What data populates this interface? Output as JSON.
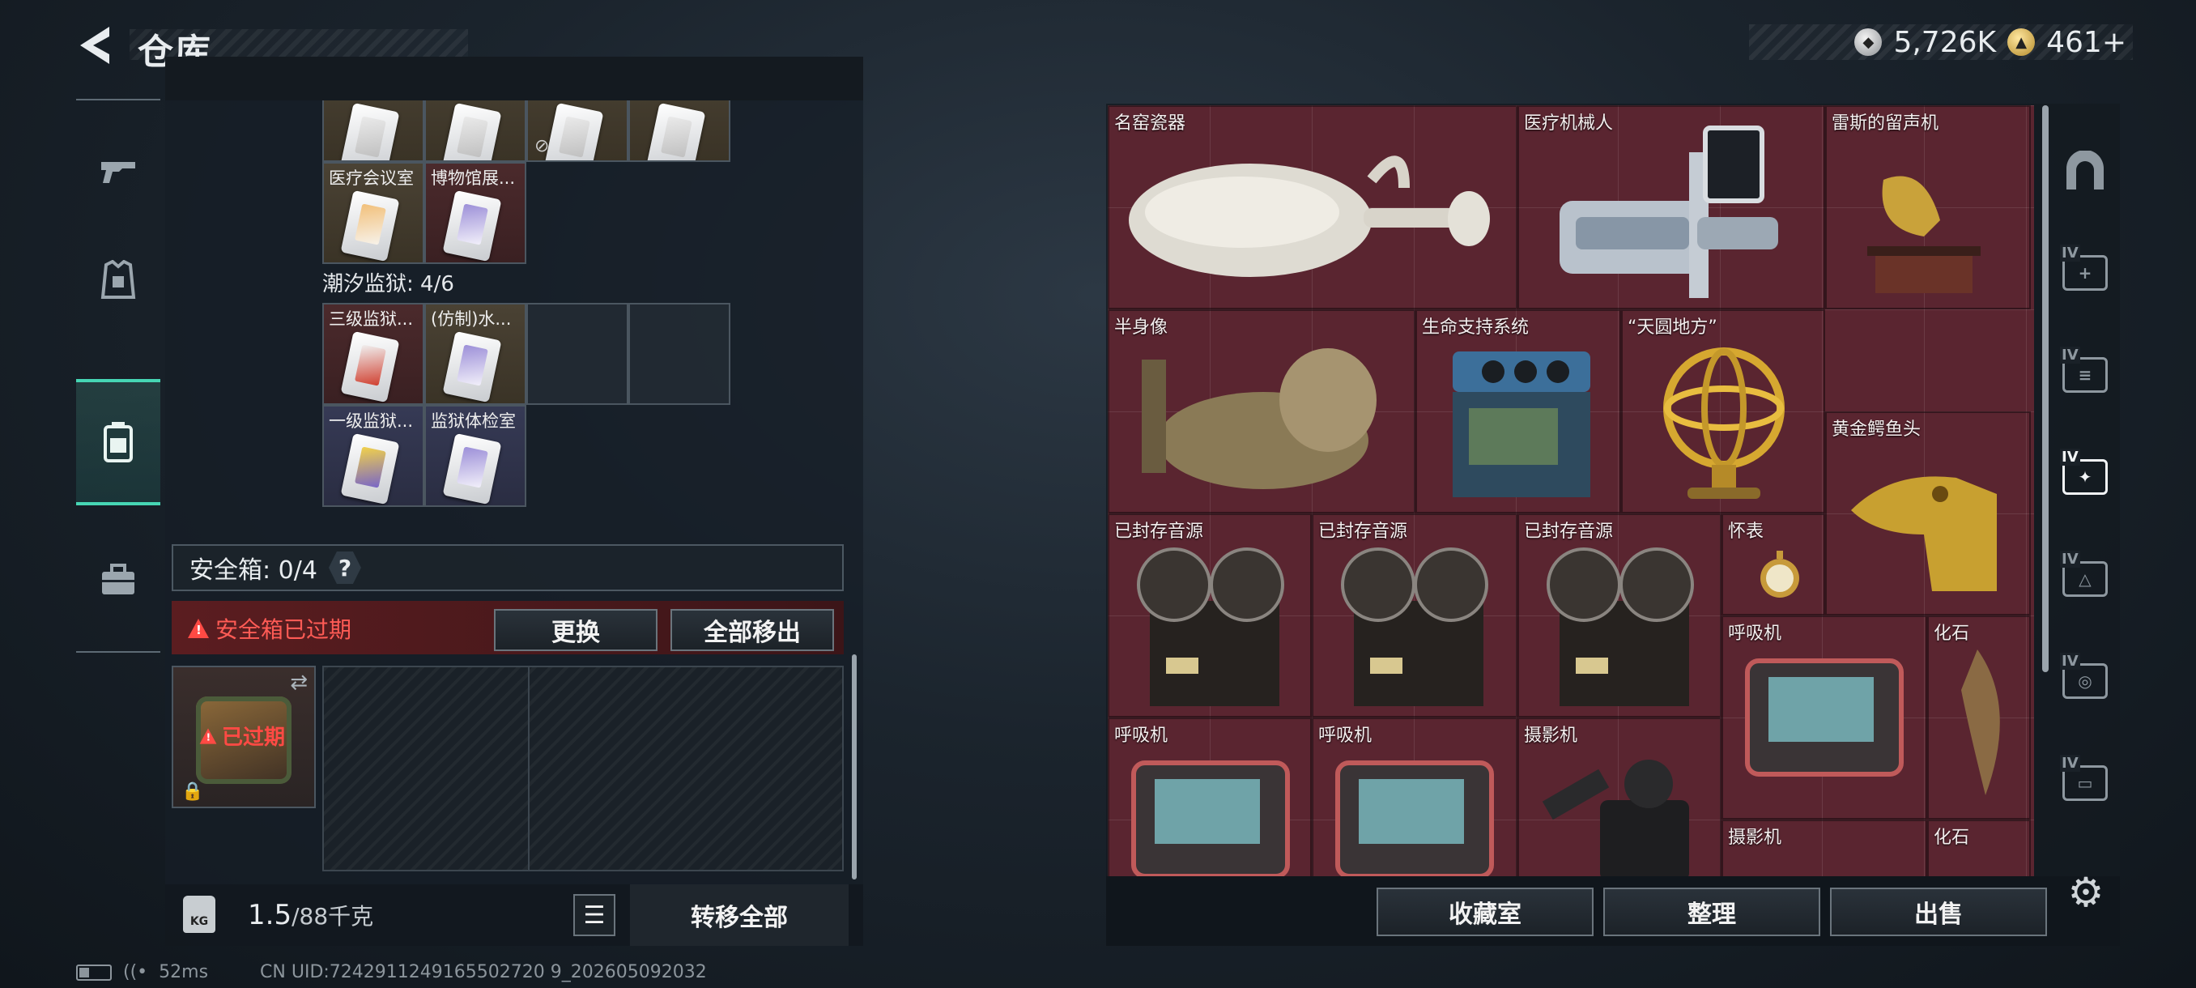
{
  "header": {
    "title": "仓库",
    "currency_silver": "5,726K",
    "currency_gold": "461+"
  },
  "left_panel": {
    "top_row_slots": [
      "",
      "",
      "",
      ""
    ],
    "row2": [
      {
        "label": "医疗会议室",
        "color": "orange"
      },
      {
        "label": "博物馆展...",
        "color": "purple"
      }
    ],
    "section_label": "潮汐监狱: 4/6",
    "prison_cards": [
      {
        "label": "三级监狱...",
        "color": "red"
      },
      {
        "label": "(仿制)水...",
        "color": "purple"
      },
      {
        "label": "一级监狱...",
        "color": "yellow"
      },
      {
        "label": "监狱体检室",
        "color": "purple"
      }
    ],
    "safebox_label": "安全箱: 0/4",
    "help": "?",
    "warning": "安全箱已过期",
    "replace_button": "更换",
    "move_all_out_button": "全部移出",
    "expired_stamp": "已过期",
    "weight_icon_text": "KG",
    "weight_current": "1.5",
    "weight_max": "/88千克",
    "transfer_all_button": "转移全部"
  },
  "collection": {
    "items": [
      {
        "label": "名窑瓷器"
      },
      {
        "label": "医疗机械人"
      },
      {
        "label": "雷斯的留声机"
      },
      {
        "label": "半身像"
      },
      {
        "label": "生命支持系统"
      },
      {
        "label": "“天圆地方”"
      },
      {
        "label": "黄金鳄鱼头"
      },
      {
        "label": "已封存音源"
      },
      {
        "label": "已封存音源"
      },
      {
        "label": "已封存音源"
      },
      {
        "label": "怀表"
      },
      {
        "label": "呼吸机"
      },
      {
        "label": "化石"
      },
      {
        "label": "呼吸机"
      },
      {
        "label": "呼吸机"
      },
      {
        "label": "摄影机"
      },
      {
        "label": "摄影机"
      },
      {
        "label": "化石"
      }
    ],
    "collection_room_button": "收藏室",
    "organize_button": "整理",
    "sell_button": "出售"
  },
  "right_tabs": [
    "",
    "IV",
    "IV",
    "IV",
    "IV",
    "IV",
    "IV"
  ],
  "status": {
    "ping": "52ms",
    "uid": "CN UID:7242911249165502720 9_202605092032"
  },
  "colors": {
    "accent": "#46d6b4",
    "warning": "#ff4a44",
    "collection_bg": "#5a2530"
  }
}
